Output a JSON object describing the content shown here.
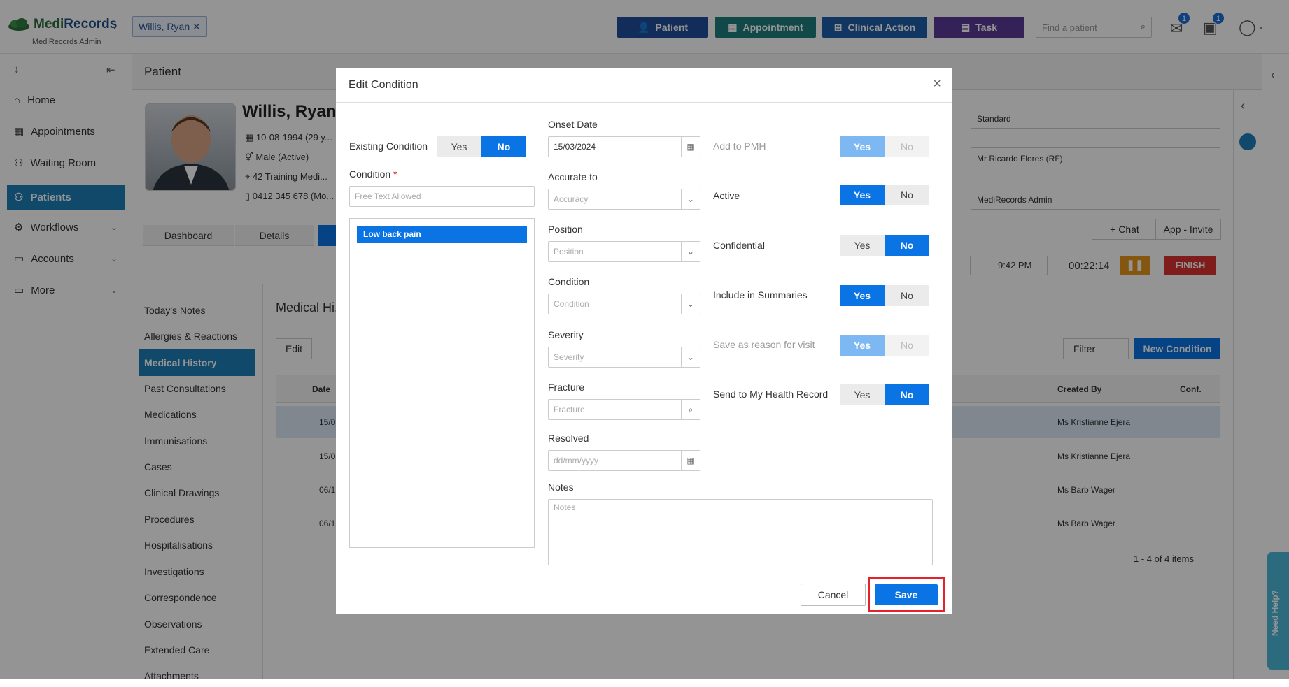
{
  "app": {
    "brand_a": "Medi",
    "brand_b": "Records",
    "subtitle": "MediRecords Admin"
  },
  "topbar": {
    "patient_tab": "Willis, Ryan",
    "buttons": [
      {
        "label": "Patient",
        "color": "#1f4e99"
      },
      {
        "label": "Appointment",
        "color": "#1c7f7a"
      },
      {
        "label": "Clinical Action",
        "color": "#1e5ea8"
      },
      {
        "label": "Task",
        "color": "#5b3a98"
      }
    ],
    "search_placeholder": "Find a patient",
    "mail_count": "1",
    "task_count": "1"
  },
  "sidebar": {
    "items": [
      "Home",
      "Appointments",
      "Waiting Room",
      "Patients",
      "Workflows",
      "Accounts",
      "More"
    ]
  },
  "page": {
    "title": "Patient",
    "patient_name": "Willis, Ryan",
    "dob": "10-08-1994 (29 y...",
    "gender": "Male (Active)",
    "address": "42 Training Medi...",
    "phone": "0412 345 678 (Mo..."
  },
  "tabs": [
    "Dashboard",
    "Details"
  ],
  "subnav": [
    "Today's Notes",
    "Allergies & Reactions",
    "Medical History",
    "Past Consultations",
    "Medications",
    "Immunisations",
    "Cases",
    "Clinical Drawings",
    "Procedures",
    "Hospitalisations",
    "Investigations",
    "Correspondence",
    "Observations",
    "Extended Care",
    "Attachments"
  ],
  "right_panel": {
    "standard": "Standard",
    "provider": "Mr Ricardo Flores (RF)",
    "admin": "MediRecords Admin",
    "chat": "Chat",
    "invite": "App - Invite",
    "time": "9:42 PM",
    "timer": "00:22:14",
    "finish": "FINISH"
  },
  "history": {
    "title": "Medical Hi...",
    "edit": "Edit",
    "filter": "Filter",
    "new_condition": "New Condition",
    "columns": {
      "date": "Date",
      "created_by": "Created By",
      "conf": "Conf."
    },
    "rows": [
      {
        "date": "15/0",
        "created": "Ms Kristianne Ejera"
      },
      {
        "date": "15/0",
        "created": "Ms Kristianne Ejera"
      },
      {
        "date": "06/1",
        "created": "Ms Barb Wager"
      },
      {
        "date": "06/1",
        "created": "Ms Barb Wager"
      }
    ],
    "pager": "1 - 4 of 4 items"
  },
  "modal": {
    "title": "Edit Condition",
    "existing_condition": "Existing Condition",
    "yes": "Yes",
    "no": "No",
    "condition_label": "Condition",
    "required": "*",
    "condition_placeholder": "Free Text Allowed",
    "selected_condition": "Low back pain",
    "onset_date_label": "Onset Date",
    "onset_date_value": "15/03/2024",
    "accurate_to_label": "Accurate to",
    "accuracy_placeholder": "Accuracy",
    "position_label": "Position",
    "position_placeholder": "Position",
    "condition2_label": "Condition",
    "condition2_placeholder": "Condition",
    "severity_label": "Severity",
    "severity_placeholder": "Severity",
    "fracture_label": "Fracture",
    "fracture_placeholder": "Fracture",
    "resolved_label": "Resolved",
    "resolved_placeholder": "dd/mm/yyyy",
    "notes_label": "Notes",
    "notes_placeholder": "Notes",
    "add_to_pmh": "Add to PMH",
    "active": "Active",
    "confidential": "Confidential",
    "include_summaries": "Include in Summaries",
    "save_reason": "Save as reason for visit",
    "send_mhr": "Send to My Health Record",
    "cancel": "Cancel",
    "save": "Save"
  },
  "help": "Need Help?"
}
